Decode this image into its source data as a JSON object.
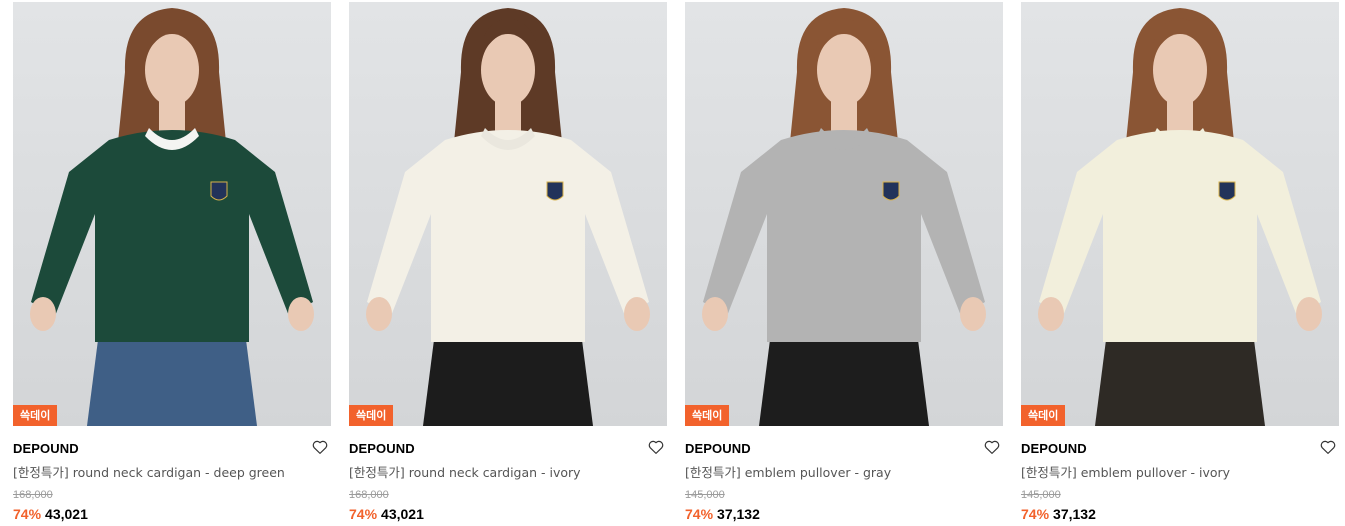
{
  "products": [
    {
      "badge": "쓱데이",
      "brand": "DEPOUND",
      "name": "[한정특가] round neck cardigan - deep green",
      "original_price": "168,000",
      "discount": "74%",
      "price": "43,021",
      "colors": {
        "top": "#1c4a3a",
        "bottom": "#3f5f86",
        "hair": "#7a4a2e",
        "collar": "#f4f4f2"
      }
    },
    {
      "badge": "쓱데이",
      "brand": "DEPOUND",
      "name": "[한정특가] round neck cardigan - ivory",
      "original_price": "168,000",
      "discount": "74%",
      "price": "43,021",
      "colors": {
        "top": "#f3f0e6",
        "bottom": "#1c1c1c",
        "hair": "#5e3a26",
        "collar": "#eae7de"
      }
    },
    {
      "badge": "쓱데이",
      "brand": "DEPOUND",
      "name": "[한정특가] emblem pullover - gray",
      "original_price": "145,000",
      "discount": "74%",
      "price": "37,132",
      "colors": {
        "top": "#b3b3b3",
        "bottom": "#1d1d1d",
        "hair": "#8a5534",
        "collar": "#b3b3b3"
      }
    },
    {
      "badge": "쓱데이",
      "brand": "DEPOUND",
      "name": "[한정특가] emblem pullover - ivory",
      "original_price": "145,000",
      "discount": "74%",
      "price": "37,132",
      "colors": {
        "top": "#f2efdc",
        "bottom": "#2e2a25",
        "hair": "#8a5534",
        "collar": "#f2efdc"
      }
    }
  ],
  "icons": {
    "wishlist": "heart-outline-icon"
  },
  "accent_color": "#f2622c"
}
